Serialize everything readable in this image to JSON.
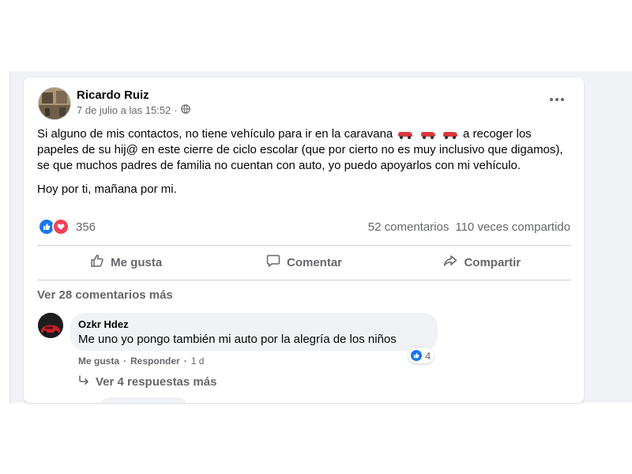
{
  "post": {
    "author": "Ricardo Ruiz",
    "date": "7 de julio a las 15:52",
    "separator": "·",
    "paragraph1_before": "Si alguno de mis contactos, no tiene vehículo para ir en la caravana",
    "paragraph1_after": "a recoger los papeles de su hij@ en este cierre de ciclo escolar (que por cierto no es muy inclusivo que digamos), se que muchos padres de familia no cuentan con auto, yo puedo apoyarlos con mi vehículo.",
    "paragraph2": "Hoy por ti, mañana por mi.",
    "reaction_count": "356",
    "comments_count": "52 comentarios",
    "shares_count": "110 veces compartido",
    "more_icon": "more-options-icon"
  },
  "actions": {
    "like": "Me gusta",
    "comment": "Comentar",
    "share": "Compartir"
  },
  "comments": {
    "view_more": "Ver 28 comentarios más",
    "items": [
      {
        "author": "Ozkr Hdez",
        "text": "Me uno yo pongo también mi auto por la alegría de los niños",
        "like_label": "Me gusta",
        "reply_label": "Responder",
        "time": "1 d",
        "reaction_count": "4",
        "replies_label": "Ver 4 respuestas más"
      }
    ]
  },
  "colors": {
    "facebook_blue": "#1877f2",
    "love_red": "#f33e58",
    "secondary_text": "#65676b",
    "bubble_bg": "#f0f2f5"
  }
}
